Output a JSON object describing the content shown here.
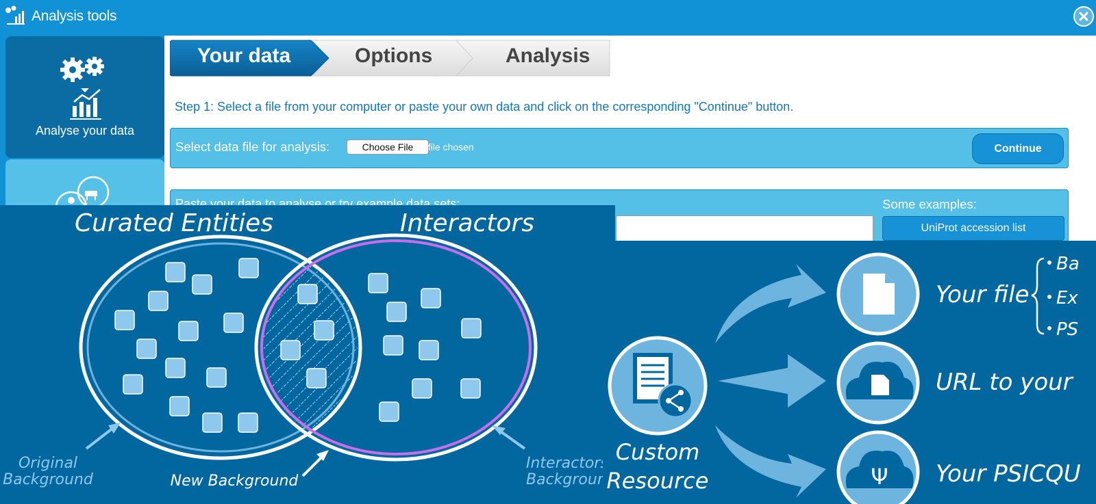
{
  "window": {
    "title": "Analysis tools",
    "icon": "analysis-chart-icon",
    "close_icon": "close-icon"
  },
  "sidebar": {
    "items": [
      {
        "label": "Analyse your data",
        "icon": "gears-chart-icon"
      },
      {
        "label": "",
        "icon": "species-people-icon"
      }
    ]
  },
  "wizard": {
    "steps": [
      "Your data",
      "Options",
      "Analysis"
    ],
    "active": 0
  },
  "instruction": "Step 1: Select a file from your computer or paste your own data and click on the corresponding \"Continue\" button.",
  "file_section": {
    "label": "Select data file for analysis:",
    "choose_button": "Choose File",
    "status": "No file chosen",
    "continue_button": "Continue"
  },
  "paste_section": {
    "label": "Paste your data to analyse or try example data sets:",
    "examples_label": "Some examples:",
    "example_button": "UniProt accession list"
  },
  "venn_diagram": {
    "set_left": "Curated Entities",
    "set_right": "Interactors",
    "annotation_left": [
      "Original",
      "Background"
    ],
    "annotation_center": "New Background",
    "annotation_right": [
      "Interactors",
      "Background"
    ]
  },
  "resource_diagram": {
    "source": [
      "Custom",
      "Resource"
    ],
    "targets": [
      "Your file",
      "URL to your",
      "Your PSICQU"
    ],
    "bullets": [
      "Ba",
      "Ex",
      "PS"
    ]
  },
  "colors": {
    "title_bar": "#1192d6",
    "side_active": "#0b6ca3",
    "panel_blue": "#54bfe7",
    "diagram_bg": "#02679f",
    "venn_right_ring": "#c86ee8"
  }
}
